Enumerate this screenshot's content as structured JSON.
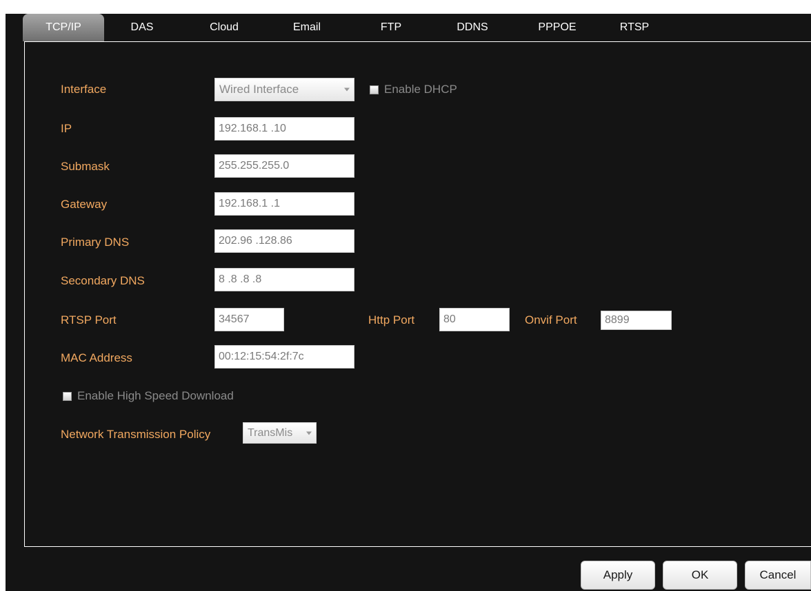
{
  "tabs": [
    {
      "label": "TCP/IP"
    },
    {
      "label": "DAS"
    },
    {
      "label": "Cloud"
    },
    {
      "label": "Email"
    },
    {
      "label": "FTP"
    },
    {
      "label": "DDNS"
    },
    {
      "label": "PPPOE"
    },
    {
      "label": "RTSP"
    }
  ],
  "form": {
    "interface": {
      "label": "Interface",
      "value": "Wired Interface"
    },
    "dhcp": {
      "label": "Enable DHCP",
      "checked": false
    },
    "ip": {
      "label": "IP",
      "value": "192.168.1 .10"
    },
    "submask": {
      "label": "Submask",
      "value": "255.255.255.0"
    },
    "gateway": {
      "label": "Gateway",
      "value": "192.168.1 .1"
    },
    "primary_dns": {
      "label": "Primary DNS",
      "value": "202.96 .128.86"
    },
    "secondary_dns": {
      "label": "Secondary DNS",
      "value": "8 .8 .8 .8"
    },
    "rtsp_port": {
      "label": "RTSP Port",
      "value": "34567"
    },
    "http_port": {
      "label": "Http Port",
      "value": "80"
    },
    "onvif_port": {
      "label": "Onvif Port",
      "value": "8899"
    },
    "mac_address": {
      "label": "MAC Address",
      "value": "00:12:15:54:2f:7c"
    },
    "high_speed": {
      "label": "Enable High Speed Download",
      "checked": false
    },
    "policy": {
      "label": "Network Transmission Policy",
      "value": "TransMis"
    }
  },
  "buttons": {
    "apply": "Apply",
    "ok": "OK",
    "cancel": "Cancel"
  },
  "colors": {
    "background": "#141414",
    "label": "#f1a860",
    "active_tab": "#8c8c8c"
  }
}
